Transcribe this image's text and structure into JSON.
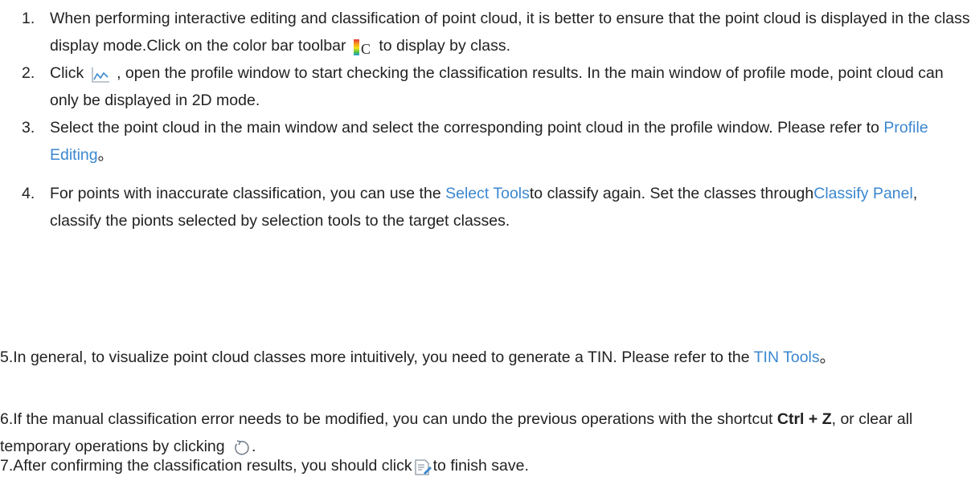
{
  "steps": [
    {
      "number": "1.",
      "text_a": "When performing interactive editing and classification of point cloud, it is better to ensure that the point cloud is displayed in the class display mode.Click on the color bar toolbar",
      "icon": "colorbar-class-icon",
      "text_b": "to display by class."
    },
    {
      "number": "2.",
      "text_a": "Click",
      "icon": "profile-icon",
      "text_b": ", open the profile window to start checking the classification results. In the main window of profile mode, point cloud can only be displayed in 2D mode."
    },
    {
      "number": "3.",
      "text_a": "Select the point cloud in the main window and select the corresponding point cloud in the profile window. Please refer to ",
      "link": "Profile Editing",
      "text_b": "。"
    },
    {
      "number": "4.",
      "text_a": "For points with inaccurate classification, you can use the ",
      "link1": "Select Tools",
      "text_b": "to classify again. Set the classes through",
      "link2": "Classify Panel",
      "text_c": ", classify the pionts selected by selection tools to the target classes."
    }
  ],
  "para5": {
    "text_a": "5.In general, to visualize point cloud classes more intuitively, you need to generate a TIN. Please refer to the ",
    "link": "TIN Tools",
    "text_b": "。"
  },
  "para6": {
    "text_a": "6.If the manual classification error needs to be modified, you can undo the previous operations with the shortcut ",
    "shortcut": "Ctrl + Z",
    "text_b": ", or clear all temporary operations by clicking ",
    "icon": "clear-icon",
    "text_c": "."
  },
  "para7": {
    "text_a": "7.After confirming the classification results, you should click",
    "icon": "save-icon",
    "text_b": "to finish save."
  },
  "colors": {
    "text": "#222222",
    "link": "#3b87cf"
  }
}
